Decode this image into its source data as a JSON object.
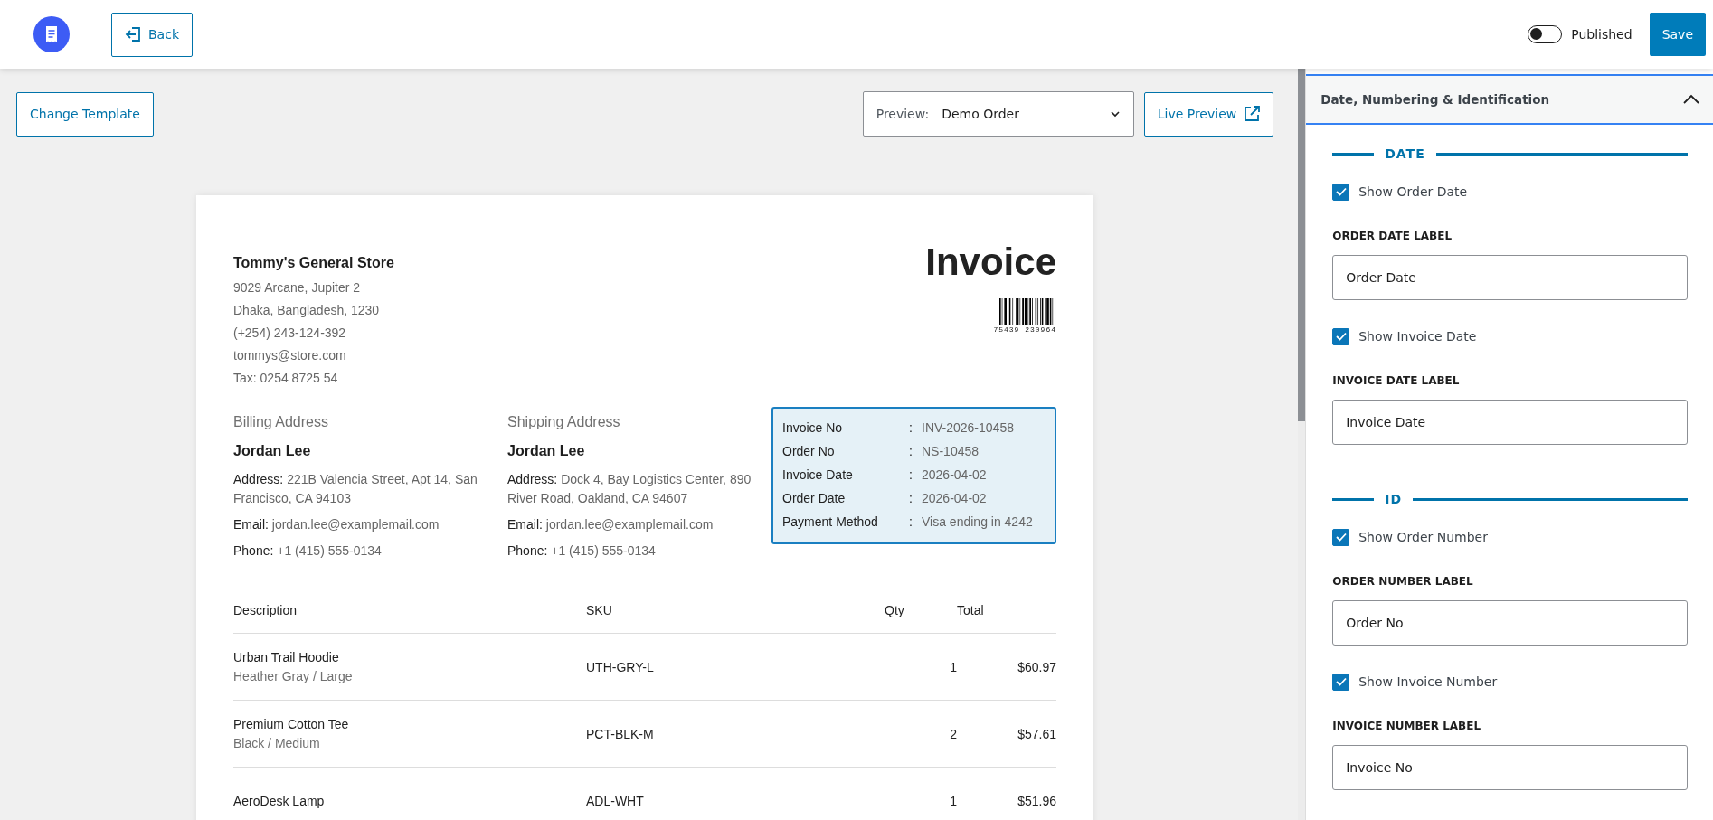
{
  "topbar": {
    "back": "Back",
    "published": {
      "label": "Published",
      "on": false
    },
    "save": "Save"
  },
  "toolbar": {
    "change_template": "Change Template",
    "preview_label": "Preview:",
    "preview_value": "Demo Order",
    "live_preview": "Live Preview"
  },
  "invoice": {
    "store_name": "Tommy's General Store",
    "store_lines": [
      "9029 Arcane, Jupiter 2",
      "Dhaka, Bangladesh, 1230",
      "(+254) 243-124-392",
      "tommys@store.com",
      "Tax: 0254 8725 54"
    ],
    "title": "Invoice",
    "barcode_number": "75439 230964",
    "addresses": [
      {
        "heading": "Billing Address",
        "name": "Jordan Lee",
        "lines": [
          {
            "label": "Address:",
            "value": "221B Valencia Street, Apt 14, San Francisco, CA 94103"
          },
          {
            "label": "Email:",
            "value": "jordan.lee@examplemail.com"
          },
          {
            "label": "Phone:",
            "value": "+1 (415) 555-0134"
          }
        ]
      },
      {
        "heading": "Shipping Address",
        "name": "Jordan Lee",
        "lines": [
          {
            "label": "Address:",
            "value": "Dock 4, Bay Logistics Center, 890 River Road, Oakland, CA 94607"
          },
          {
            "label": "Email:",
            "value": "jordan.lee@examplemail.com"
          },
          {
            "label": "Phone:",
            "value": "+1 (415) 555-0134"
          }
        ]
      }
    ],
    "meta": [
      {
        "label": "Invoice No",
        "separator": ":",
        "value": "INV-2026-10458"
      },
      {
        "label": "Order No",
        "separator": ":",
        "value": "NS-10458"
      },
      {
        "label": "Invoice Date",
        "separator": ":",
        "value": "2026-04-02"
      },
      {
        "label": "Order Date",
        "separator": ":",
        "value": "2026-04-02"
      },
      {
        "label": "Payment Method",
        "separator": ":",
        "value": "Visa ending in 4242"
      }
    ],
    "table": {
      "columns": [
        "Description",
        "SKU",
        "Qty",
        "Total"
      ],
      "rows": [
        {
          "description": "Urban Trail Hoodie",
          "variant": "Heather Gray / Large",
          "sku": "UTH-GRY-L",
          "qty": "1",
          "total": "$60.97"
        },
        {
          "description": "Premium Cotton Tee",
          "variant": "Black / Medium",
          "sku": "PCT-BLK-M",
          "qty": "2",
          "total": "$57.61"
        },
        {
          "description": "AeroDesk Lamp",
          "sku": "ADL-WHT",
          "qty": "1",
          "total": "$51.96"
        }
      ]
    }
  },
  "settings": {
    "title": "Date, Numbering & Identification",
    "expanded": true,
    "sections": [
      {
        "title": "DATE",
        "items": [
          {
            "kind": "checkbox",
            "label": "Show Order Date",
            "checked": true
          },
          {
            "kind": "field",
            "label": "ORDER DATE LABEL",
            "value": "Order Date"
          },
          {
            "kind": "checkbox",
            "label": "Show Invoice Date",
            "checked": true
          },
          {
            "kind": "field",
            "label": "INVOICE DATE LABEL",
            "value": "Invoice Date"
          }
        ]
      },
      {
        "title": "ID",
        "items": [
          {
            "kind": "checkbox",
            "label": "Show Order Number",
            "checked": true
          },
          {
            "kind": "field",
            "label": "ORDER NUMBER LABEL",
            "value": "Order No"
          },
          {
            "kind": "checkbox",
            "label": "Show Invoice Number",
            "checked": true
          },
          {
            "kind": "field",
            "label": "INVOICE NUMBER LABEL",
            "value": "Invoice No"
          }
        ]
      }
    ]
  }
}
